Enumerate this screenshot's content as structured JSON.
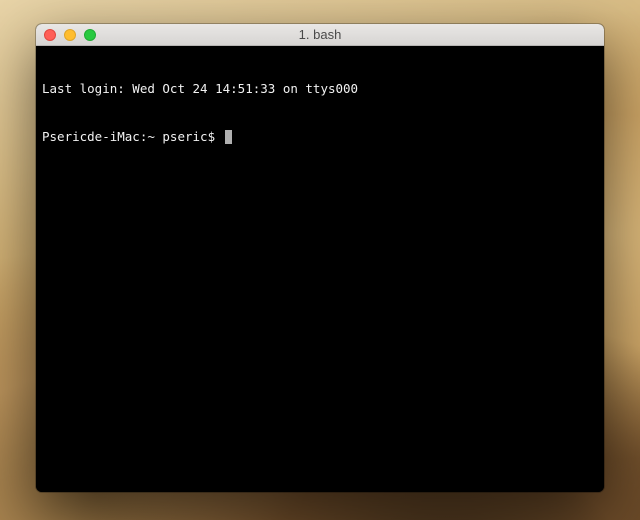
{
  "window": {
    "title": "1. bash"
  },
  "terminal": {
    "last_login_line": "Last login: Wed Oct 24 14:51:33 on ttys000",
    "prompt": "Psericde-iMac:~ pseric$ "
  }
}
